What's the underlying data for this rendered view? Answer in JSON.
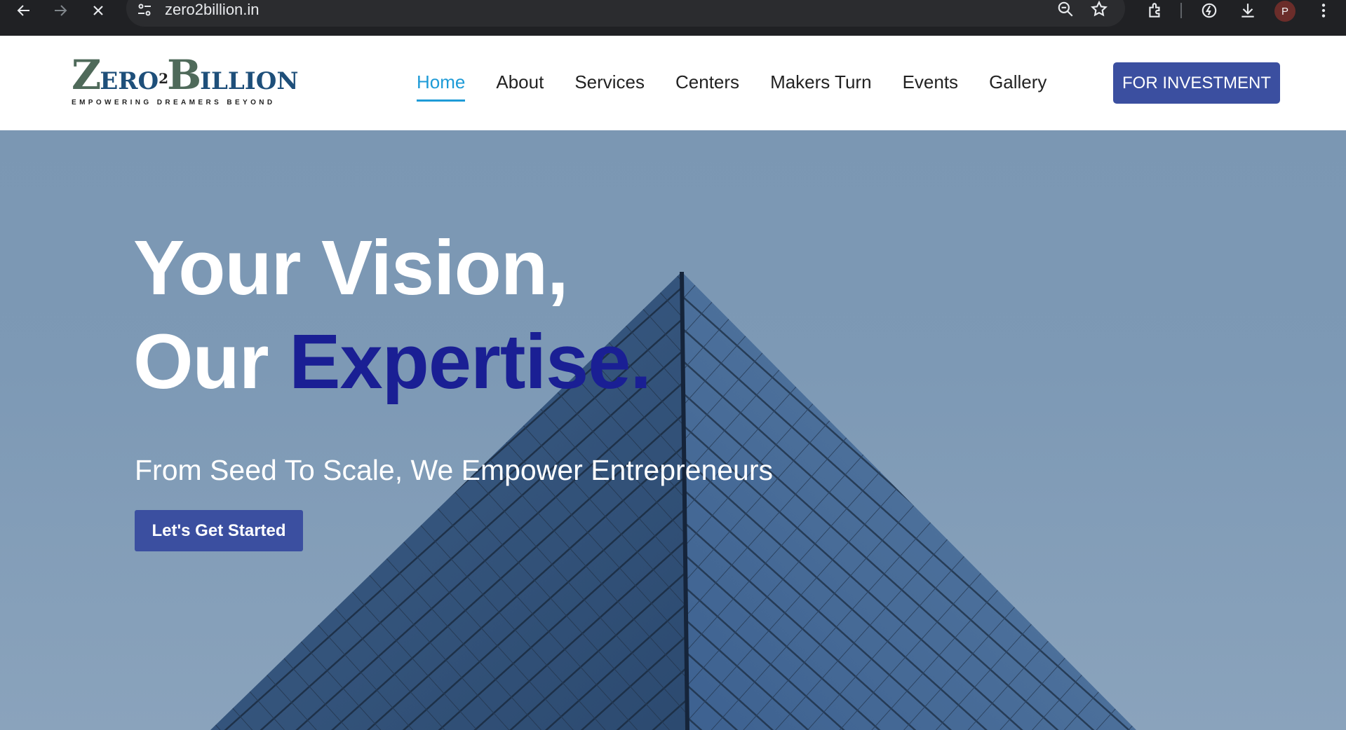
{
  "browser": {
    "url": "zero2billion.in",
    "profile_initial": "P",
    "icons": [
      "back-arrow-icon",
      "forward-arrow-icon",
      "close-icon",
      "site-settings-icon",
      "zoom-icon",
      "star-icon",
      "extensions-icon",
      "performance-icon",
      "download-icon",
      "more-vert-icon"
    ]
  },
  "logo": {
    "z": "Z",
    "ero": "ERO",
    "two": "2",
    "b": "B",
    "illion": "ILLION",
    "tagline": "EMPOWERING DREAMERS BEYOND"
  },
  "nav": {
    "items": [
      {
        "label": "Home",
        "active": true
      },
      {
        "label": "About"
      },
      {
        "label": "Services"
      },
      {
        "label": "Centers"
      },
      {
        "label": "Makers Turn"
      },
      {
        "label": "Events"
      },
      {
        "label": "Gallery"
      }
    ],
    "invest_label": "FOR INVESTMENT"
  },
  "hero": {
    "line1": "Your Vision,",
    "line2_prefix": "Our ",
    "line2_accent": "Expertise.",
    "subtitle": "From Seed To Scale, We Empower Entrepreneurs",
    "cta_label": "Let's Get Started"
  },
  "colors": {
    "accent": "#3b4fa0",
    "nav_active": "#1e9bd7",
    "hero_accent_text": "#1a1f94"
  }
}
